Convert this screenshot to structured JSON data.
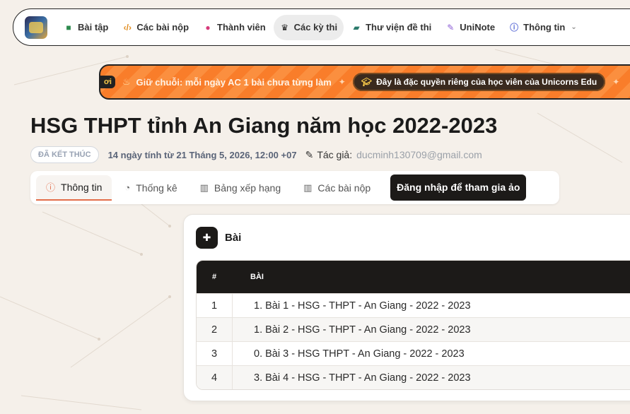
{
  "nav": {
    "items": [
      {
        "label": "Bài tập",
        "icon": "book-icon"
      },
      {
        "label": "Các bài nộp",
        "icon": "code-icon"
      },
      {
        "label": "Thành viên",
        "icon": "users-icon"
      },
      {
        "label": "Các kỳ thi",
        "icon": "trophy-icon",
        "active": true
      },
      {
        "label": "Thư viện đề thi",
        "icon": "folder-icon"
      },
      {
        "label": "UniNote",
        "icon": "edit-icon"
      },
      {
        "label": "Thông tin",
        "icon": "info-icon"
      }
    ]
  },
  "banner": {
    "tag": "ơi",
    "streak_text": "Giữ chuỗi: mỗi ngày AC 1 bài chưa từng làm",
    "pill_text": "Đây là đặc quyền riêng của học viên của Unicorns Edu"
  },
  "contest": {
    "title": "HSG THPT tỉnh An Giang năm học 2022-2023",
    "status": "ĐÃ KẾT THÚC",
    "time_info": "14 ngày tính từ 21 Tháng 5, 2026, 12:00 +07",
    "author_label": "Tác giả:",
    "author_email": "ducminh130709@gmail.com"
  },
  "tabs": {
    "info": "Thông tin",
    "stats": "Thống kê",
    "ranking": "Bảng xếp hạng",
    "submissions": "Các bài nộp",
    "join": "Đăng nhập để tham gia ảo"
  },
  "problems": {
    "title": "Bài",
    "headers": {
      "num": "#",
      "name": "BÀI"
    },
    "rows": [
      {
        "num": "1",
        "name": "1. Bài 1 - HSG - THPT - An Giang - 2022 - 2023"
      },
      {
        "num": "2",
        "name": "1. Bài 2 - HSG - THPT - An Giang - 2022 - 2023"
      },
      {
        "num": "3",
        "name": "0. Bài 3 - HSG THPT - An Giang - 2022 - 2023"
      },
      {
        "num": "4",
        "name": "3. Bài 4 - HSG - THPT - An Giang - 2022 - 2023"
      }
    ]
  }
}
